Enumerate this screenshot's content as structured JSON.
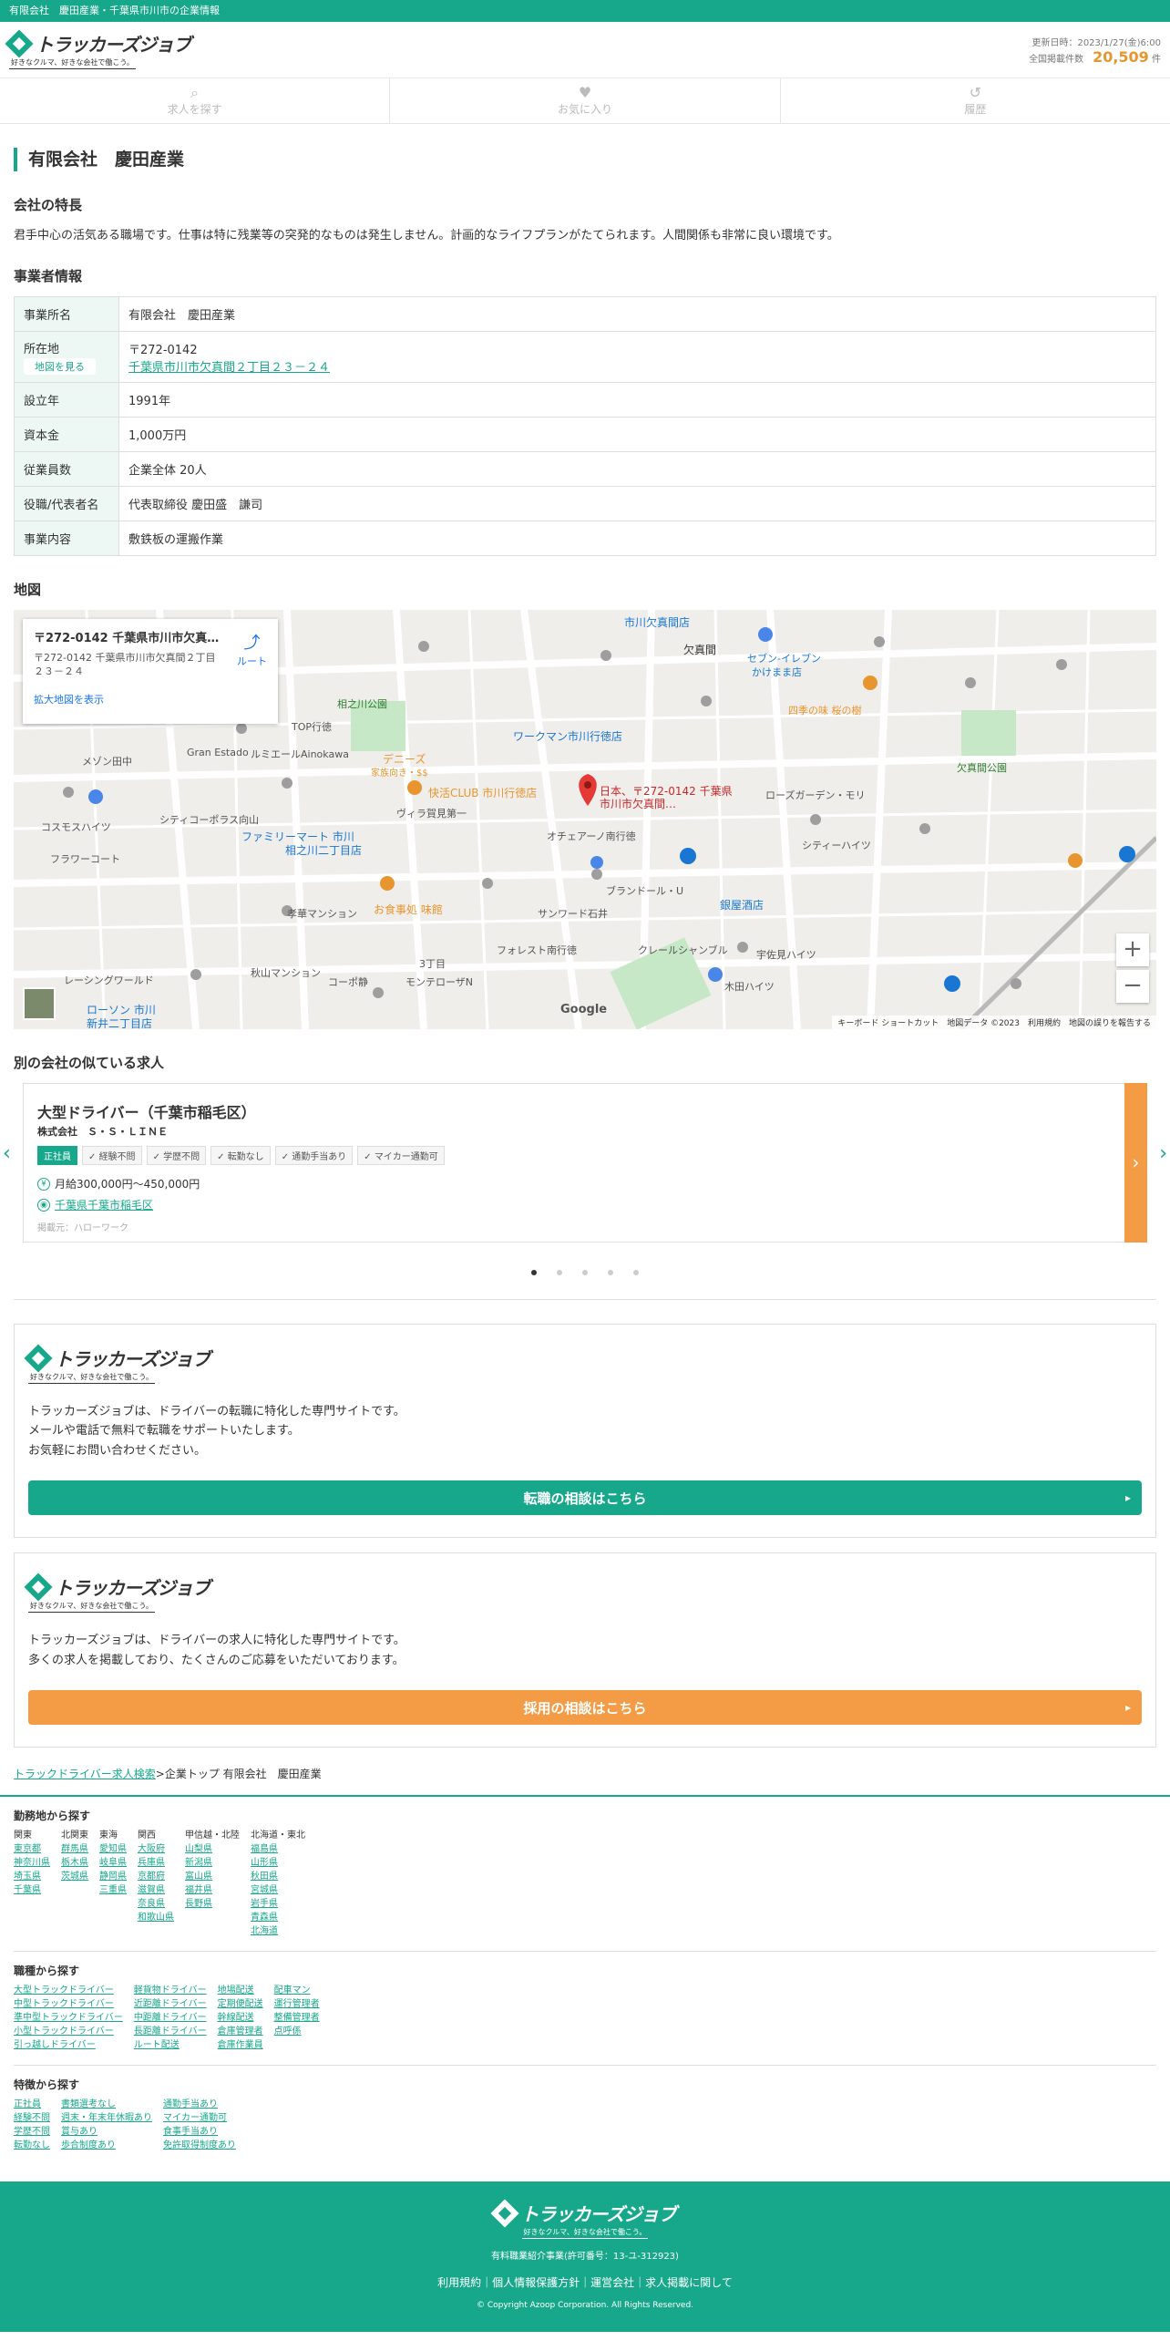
{
  "topbar": "有限会社　慶田産業・千葉県市川市の企業情報",
  "logo": {
    "text": "トラッカーズジョブ",
    "tagline": "好きなクルマ、好きな会社で働こう。"
  },
  "header": {
    "updated": "更新日時：2023/1/27(金)6:00",
    "count_label": "全国掲載件数",
    "count": "20,509",
    "count_unit": "件"
  },
  "nav": [
    {
      "label": "求人を探す",
      "icon": "search-icon"
    },
    {
      "label": "お気に入り",
      "icon": "heart-icon"
    },
    {
      "label": "履歴",
      "icon": "history-icon"
    }
  ],
  "company": {
    "name": "有限会社　慶田産業"
  },
  "features": {
    "title": "会社の特長",
    "text": "君手中心の活気ある職場です。仕事は特に残業等の突発的なものは発生しません。計画的なライフプランがたてられます。人間関係も非常に良い環境です。"
  },
  "info": {
    "title": "事業者情報",
    "rows": [
      {
        "label": "事業所名",
        "value": "有限会社　慶田産業"
      },
      {
        "label": "所在地",
        "value": "〒272-0142",
        "link": "千葉県市川市欠真間２丁目２３－２４",
        "button": "地図を見る"
      },
      {
        "label": "設立年",
        "value": "1991年"
      },
      {
        "label": "資本金",
        "value": "1,000万円"
      },
      {
        "label": "従業員数",
        "value": "企業全体 20人"
      },
      {
        "label": "役職/代表者名",
        "value": "代表取締役 慶田盛　謙司"
      },
      {
        "label": "事業内容",
        "value": "敷鉄板の運搬作業"
      }
    ]
  },
  "map": {
    "title": "地図",
    "info_title": "〒272-0142 千葉県市川市欠真間２丁目２３－２４",
    "info_address": "〒272-0142 千葉県市川市欠真間２丁目２３－２４",
    "info_link": "拡大地図を表示",
    "route": "ルート",
    "pin_label": "日本、〒272-0142 千葉県市川市欠真間…",
    "labels": [
      "相之川公園",
      "デニーズ",
      "家族向き・$$",
      "快活CLUB 市川行徳店",
      "ワークマン市川行徳店",
      "セブン-イレブン",
      "かけまま店",
      "四季の味 桜の樹",
      "欠真間公園",
      "ファミリーマート 市川",
      "相之川二丁目店",
      "お食事処 味館",
      "銀屋酒店",
      "ローソン 市川",
      "新井二丁目店",
      "欠真間",
      "市川欠真間店",
      "ヴィラ賀見第一",
      "メゾン田中",
      "コスモスハイツ",
      "シティコーポラス向山",
      "TOP行徳",
      "Gran Estado",
      "ルミエールAinokawa",
      "オチェアーノ南行徳",
      "ローズガーデン・モリ",
      "シティーハイツ",
      "ブランドール・U",
      "サンワード石井",
      "宇佐見ハイツ",
      "木田ハイツ",
      "クレールシャンブル",
      "フォレスト南行徳",
      "3丁目",
      "モンテローザN",
      "秋山マンション",
      "孝華マンション",
      "コーポ静",
      "レーシングワールド",
      "フラワーコート"
    ],
    "zoom_in": "+",
    "zoom_out": "−",
    "attribution": "キーボード ショートカット　地図データ ©2023　利用規約　地図の誤りを報告する",
    "google": "Google"
  },
  "similar": {
    "title": "別の会社の似ている求人",
    "job": {
      "title": "大型ドライバー（千葉市稲毛区）",
      "company": "株式会社　Ｓ・Ｓ・ＬＩＮＥ",
      "tags": [
        "正社員",
        "経験不問",
        "学歴不問",
        "転勤なし",
        "通勤手当あり",
        "マイカー通勤可"
      ],
      "salary": "月給300,000円〜450,000円",
      "location": "千葉県千葉市稲毛区",
      "source": "掲載元：ハローワーク"
    }
  },
  "promo1": {
    "text1": "トラッカーズジョブは、ドライバーの転職に特化した専門サイトです。",
    "text2": "メールや電話で無料で転職をサポートいたします。",
    "text3": "お気軽にお問い合わせください。",
    "button": "転職の相談はこちら"
  },
  "promo2": {
    "text1": "トラッカーズジョブは、ドライバーの求人に特化した専門サイトです。",
    "text2": "多くの求人を掲載しており、たくさんのご応募をいただいております。",
    "button": "採用の相談はこちら"
  },
  "breadcrumb": {
    "link": "トラックドライバー求人検索",
    "sep": ">",
    "rest": "企業トップ 有限会社　慶田産業"
  },
  "footer_nav": {
    "area_title": "勤務地から探す",
    "areas": [
      {
        "h": "関東",
        "items": [
          "東京都",
          "神奈川県",
          "埼玉県",
          "千葉県"
        ]
      },
      {
        "h": "北関東",
        "items": [
          "群馬県",
          "栃木県",
          "茨城県"
        ]
      },
      {
        "h": "東海",
        "items": [
          "愛知県",
          "岐阜県",
          "静岡県",
          "三重県"
        ]
      },
      {
        "h": "関西",
        "items": [
          "大阪府",
          "兵庫県",
          "京都府",
          "滋賀県",
          "奈良県",
          "和歌山県"
        ]
      },
      {
        "h": "甲信越・北陸",
        "items": [
          "山梨県",
          "新潟県",
          "富山県",
          "福井県",
          "長野県"
        ]
      },
      {
        "h": "北海道・東北",
        "items": [
          "福島県",
          "山形県",
          "秋田県",
          "宮城県",
          "岩手県",
          "青森県",
          "北海道"
        ]
      }
    ],
    "job_title": "職種から探す",
    "jobs": [
      [
        "大型トラックドライバー",
        "中型トラックドライバー",
        "準中型トラックドライバー",
        "小型トラックドライバー",
        "引っ越しドライバー"
      ],
      [
        "軽貨物ドライバー",
        "近距離ドライバー",
        "中距離ドライバー",
        "長距離ドライバー",
        "ルート配送"
      ],
      [
        "地場配送",
        "定期便配送",
        "幹線配送",
        "倉庫管理者",
        "倉庫作業員"
      ],
      [
        "配車マン",
        "運行管理者",
        "整備管理者",
        "点呼係"
      ]
    ],
    "feat_title": "特徴から探す",
    "feats": [
      [
        "正社員",
        "経験不問",
        "学歴不問",
        "転勤なし"
      ],
      [
        "書類選考なし",
        "週末・年末年休暇あり",
        "賞与あり",
        "歩合制度あり"
      ],
      [
        "通勤手当あり",
        "マイカー通勤可",
        "食事手当あり",
        "免許取得制度あり"
      ]
    ]
  },
  "footer": {
    "license": "有料職業紹介事業(許可番号：13-ユ-312923)",
    "links": "利用規約｜個人情報保護方針｜運営会社｜求人掲載に関して",
    "copyright": "© Copyright Azoop Corporation. All Rights Reserved."
  }
}
